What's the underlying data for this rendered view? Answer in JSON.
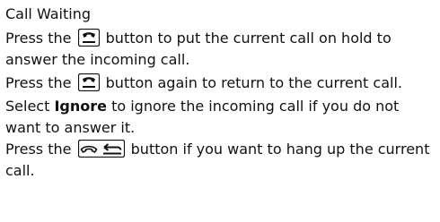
{
  "document": {
    "heading": "Call Waiting",
    "p1": {
      "before": "Press the",
      "icon": "pickup-phone-icon",
      "after": "button to put the current call on hold to answer the incoming call."
    },
    "p2": {
      "before": "Press the",
      "icon": "pickup-phone-icon",
      "after": "button again to return to the current call."
    },
    "p3": {
      "before": "Select",
      "bold": "Ignore",
      "after": "to ignore the incoming call if you do not want to answer it."
    },
    "p4": {
      "before": "Press the",
      "icon": "hangup-back-icon",
      "after": "button if you want to hang up the current call."
    }
  }
}
